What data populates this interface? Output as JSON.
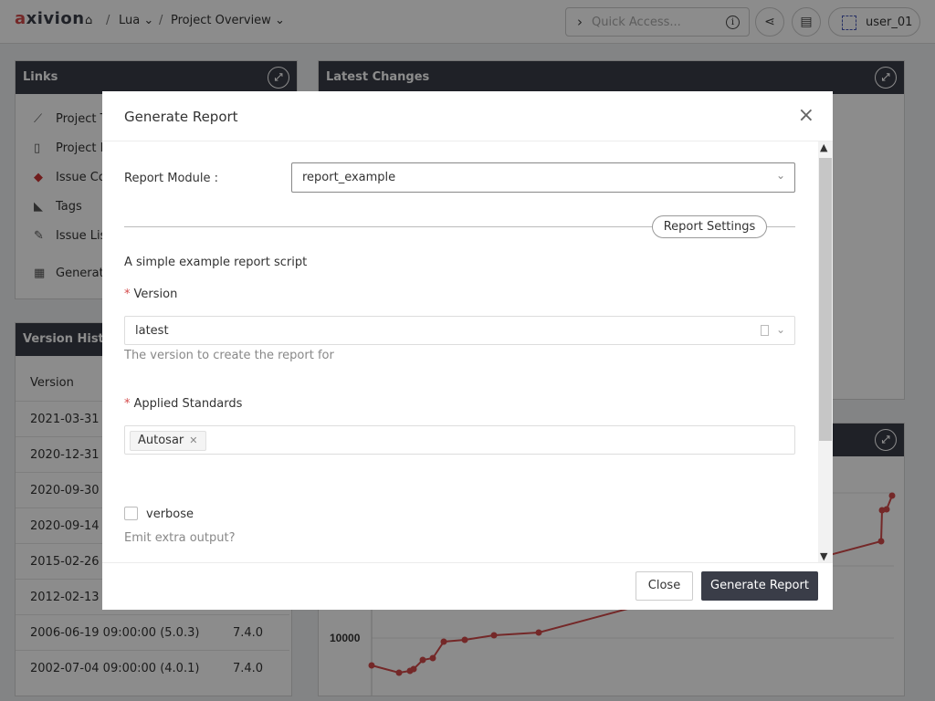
{
  "header": {
    "logo": "axivion",
    "breadcrumb": {
      "project": "Lua",
      "sep": "/",
      "page": "Project Overview"
    },
    "quick_access_placeholder": "Quick Access...",
    "user": "user_01"
  },
  "links_panel": {
    "title": "Links",
    "items": [
      {
        "label": "Project T",
        "icon": "trend-chart-icon"
      },
      {
        "label": "Project In",
        "icon": "document-icon"
      },
      {
        "label": "Issue Co",
        "icon": "issue-count-icon"
      },
      {
        "label": "Tags",
        "icon": "tag-icon"
      },
      {
        "label": "Issue Lis",
        "icon": "pencil-icon"
      },
      {
        "label": "Generate",
        "icon": "report-icon"
      }
    ]
  },
  "latest_changes": {
    "title": "Latest Changes"
  },
  "version_history": {
    "title": "Version Histor",
    "column": "Version",
    "rows": [
      {
        "version": "2021-03-31 09",
        "tool": ""
      },
      {
        "version": "2020-12-31 10",
        "tool": ""
      },
      {
        "version": "2020-09-30 0",
        "tool": ""
      },
      {
        "version": "2020-09-14 0",
        "tool": ""
      },
      {
        "version": "2015-02-26 16",
        "tool": ""
      },
      {
        "version": "2012-02-13 10",
        "tool": ""
      },
      {
        "version": "2006-06-19 09:00:00 (5.0.3)",
        "tool": "7.4.0"
      },
      {
        "version": "2002-07-04 09:00:00 (4.0.1)",
        "tool": "7.4.0"
      }
    ]
  },
  "chart": {
    "y_tick": "10000"
  },
  "modal": {
    "title": "Generate Report",
    "report_module_label": "Report Module :",
    "report_module_value": "report_example",
    "section_label": "Report Settings",
    "description": "A simple example report script",
    "version_label": "Version",
    "version_value": "latest",
    "version_hint": "The version to create the report for",
    "standards_label": "Applied Standards",
    "standards_tags": [
      "Autosar"
    ],
    "verbose_label": "verbose",
    "verbose_hint": "Emit extra output?",
    "close_label": "Close",
    "generate_label": "Generate Report"
  },
  "colors": {
    "accent": "#3a3d48",
    "required": "#d44a4a",
    "chart_line": "#d44a4a"
  }
}
